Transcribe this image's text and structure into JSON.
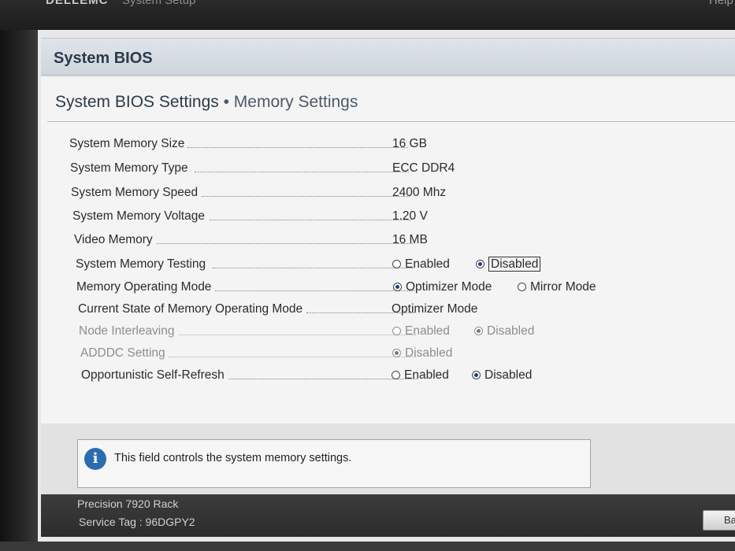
{
  "topbar": {
    "brand": "DELLEMC",
    "title": "System Setup",
    "help": "Help"
  },
  "header": {
    "title": "System BIOS"
  },
  "page": {
    "title": "System BIOS Settings",
    "subtitle": "Memory Settings",
    "separator": "•"
  },
  "settings": [
    {
      "label": "System Memory Size",
      "value": "16 GB"
    },
    {
      "label": "System Memory Type",
      "value": "ECC DDR4"
    },
    {
      "label": "System Memory Speed",
      "value": "2400 Mhz"
    },
    {
      "label": "System Memory Voltage",
      "value": "1.20 V"
    },
    {
      "label": "Video Memory",
      "value": "16 MB"
    },
    {
      "label": "System Memory Testing",
      "options": [
        "Enabled",
        "Disabled"
      ],
      "selected": "Disabled"
    },
    {
      "label": "Memory Operating Mode",
      "options": [
        "Optimizer Mode",
        "Mirror Mode"
      ],
      "selected": "Optimizer Mode"
    },
    {
      "label": "Current State of Memory Operating Mode",
      "value": "Optimizer Mode"
    },
    {
      "label": "Node Interleaving",
      "options": [
        "Enabled",
        "Disabled"
      ],
      "selected": "Disabled",
      "disabled": true
    },
    {
      "label": "ADDDC Setting",
      "options": [
        "Disabled"
      ],
      "selected": "Disabled",
      "disabled": true
    },
    {
      "label": "Opportunistic Self-Refresh",
      "options": [
        "Enabled",
        "Disabled"
      ],
      "selected": "Disabled"
    }
  ],
  "info": {
    "icon": "info-icon",
    "text": "This field controls the system memory settings."
  },
  "footer": {
    "model": "Precision 7920 Rack",
    "service_tag": "Service Tag : 96DGPY2",
    "back_button": "Back"
  },
  "colors": {
    "accent": "#2b6cb0",
    "panel": "#f4f4f4",
    "footer": "#2c2c2c"
  }
}
